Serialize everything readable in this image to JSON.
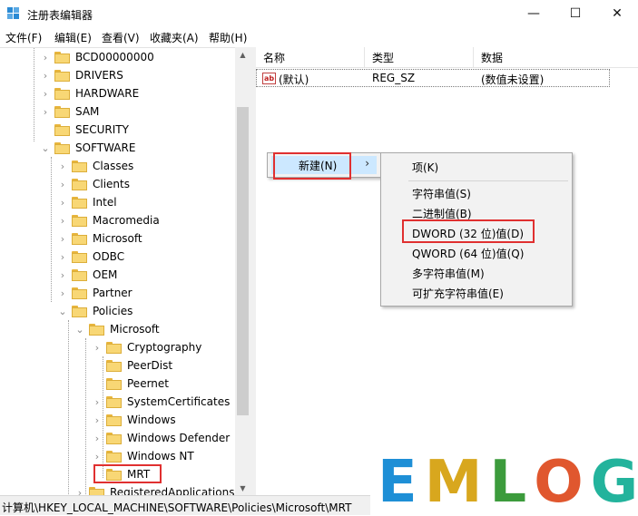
{
  "window": {
    "title": "注册表编辑器",
    "controls": {
      "minimize": "—",
      "maximize": "☐",
      "close": "✕"
    }
  },
  "menu": [
    "文件(F)",
    "编辑(E)",
    "查看(V)",
    "收藏夹(A)",
    "帮助(H)"
  ],
  "tree": {
    "items": [
      {
        "label": "BCD00000000",
        "expander": "›"
      },
      {
        "label": "DRIVERS",
        "expander": "›"
      },
      {
        "label": "HARDWARE",
        "expander": "›"
      },
      {
        "label": "SAM",
        "expander": "›"
      },
      {
        "label": "SECURITY",
        "expander": ""
      },
      {
        "label": "SOFTWARE",
        "expander": "⌄"
      },
      {
        "label": "Classes",
        "expander": "›"
      },
      {
        "label": "Clients",
        "expander": "›"
      },
      {
        "label": "Intel",
        "expander": "›"
      },
      {
        "label": "Macromedia",
        "expander": "›"
      },
      {
        "label": "Microsoft",
        "expander": "›"
      },
      {
        "label": "ODBC",
        "expander": "›"
      },
      {
        "label": "OEM",
        "expander": "›"
      },
      {
        "label": "Partner",
        "expander": "›"
      },
      {
        "label": "Policies",
        "expander": "⌄"
      },
      {
        "label": "Microsoft",
        "expander": "⌄"
      },
      {
        "label": "Cryptography",
        "expander": "›"
      },
      {
        "label": "PeerDist",
        "expander": ""
      },
      {
        "label": "Peernet",
        "expander": ""
      },
      {
        "label": "SystemCertificates",
        "expander": "›"
      },
      {
        "label": "Windows",
        "expander": "›"
      },
      {
        "label": "Windows Defender",
        "expander": "›"
      },
      {
        "label": "Windows NT",
        "expander": "›"
      },
      {
        "label": "MRT",
        "expander": ""
      },
      {
        "label": "RegisteredApplications",
        "expander": "›"
      }
    ]
  },
  "list": {
    "headers": {
      "name": "名称",
      "type": "类型",
      "data": "数据"
    },
    "rows": [
      {
        "icon": "ab",
        "name": "(默认)",
        "type": "REG_SZ",
        "data": "(数值未设置)"
      }
    ]
  },
  "context_menu": {
    "new_label": "新建(N)",
    "arrow": "›"
  },
  "submenu": {
    "items": [
      "项(K)",
      "字符串值(S)",
      "二进制值(B)",
      "DWORD (32 位)值(D)",
      "QWORD (64 位)值(Q)",
      "多字符串值(M)",
      "可扩充字符串值(E)"
    ]
  },
  "status": {
    "path": "计算机\\HKEY_LOCAL_MACHINE\\SOFTWARE\\Policies\\Microsoft\\MRT"
  },
  "watermark": {
    "letters": [
      "E",
      "M",
      "L",
      "O",
      "G"
    ],
    "colors": [
      "#1e8fd6",
      "#d8a71e",
      "#3c9b3c",
      "#e0572e",
      "#23b39c"
    ]
  },
  "colors": {
    "highlight": "#cce8ff",
    "red_box": "#e03030",
    "folder": "#f8d775"
  }
}
